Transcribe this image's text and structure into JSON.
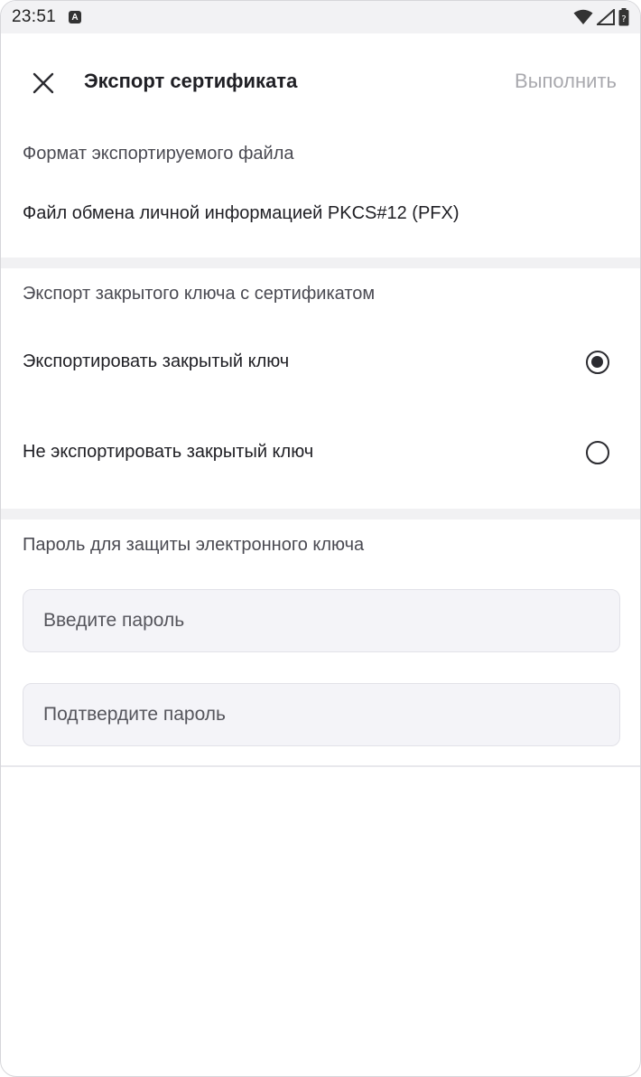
{
  "status_bar": {
    "time": "23:51",
    "notification_icon": "A"
  },
  "app_bar": {
    "title": "Экспорт сертификата",
    "action_label": "Выполнить"
  },
  "format_section": {
    "label": "Формат экспортируемого файла",
    "value": "Файл обмена личной информацией PKCS#12 (PFX)"
  },
  "key_section": {
    "label": "Экспорт закрытого ключа с сертификатом",
    "options": [
      {
        "label": "Экспортировать закрытый ключ",
        "selected": true
      },
      {
        "label": "Не экспортировать закрытый ключ",
        "selected": false
      }
    ]
  },
  "password_section": {
    "label": "Пароль для защиты электронного ключа",
    "password_placeholder": "Введите пароль",
    "confirm_placeholder": "Подтвердите пароль"
  },
  "colors": {
    "accent": "#2b2b30",
    "disabled_action": "#a9a9ae",
    "field_background": "#f4f4f8",
    "divider": "#f1f1f3"
  }
}
